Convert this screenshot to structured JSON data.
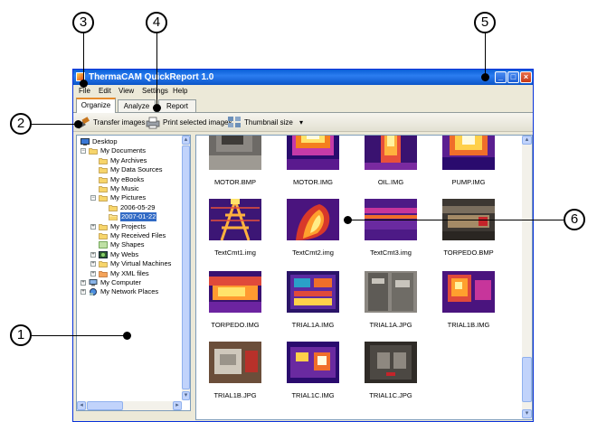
{
  "window": {
    "title": "ThermaCAM QuickReport 1.0",
    "controls": {
      "minimize": "_",
      "maximize": "□",
      "close": "×"
    }
  },
  "menu": [
    "File",
    "Edit",
    "View",
    "Settings",
    "Help"
  ],
  "tabs": [
    {
      "label": "Organize",
      "active": true
    },
    {
      "label": "Analyze",
      "active": false
    },
    {
      "label": "Report",
      "active": false
    }
  ],
  "toolbar": {
    "transfer": "Transfer images",
    "print": "Print selected images",
    "thumbnail": "Thumbnail size",
    "thumbnail_arrow": "▾"
  },
  "tree": [
    {
      "label": "Desktop",
      "level": 0,
      "expander": "",
      "icon": "desktop-icon"
    },
    {
      "label": "My Documents",
      "level": 1,
      "expander": "−",
      "icon": "folder-icon"
    },
    {
      "label": "My Archives",
      "level": 2,
      "expander": "",
      "icon": "folder-icon"
    },
    {
      "label": "My Data Sources",
      "level": 2,
      "expander": "",
      "icon": "folder-icon"
    },
    {
      "label": "My eBooks",
      "level": 2,
      "expander": "",
      "icon": "folder-icon"
    },
    {
      "label": "My Music",
      "level": 2,
      "expander": "",
      "icon": "folder-icon"
    },
    {
      "label": "My Pictures",
      "level": 2,
      "expander": "−",
      "icon": "folder-icon"
    },
    {
      "label": "2006-05-29",
      "level": 3,
      "expander": "",
      "icon": "folder-icon"
    },
    {
      "label": "2007-01-22",
      "level": 3,
      "expander": "",
      "icon": "folder-open-icon",
      "selected": true
    },
    {
      "label": "My Projects",
      "level": 2,
      "expander": "+",
      "icon": "folder-icon"
    },
    {
      "label": "My Received Files",
      "level": 2,
      "expander": "",
      "icon": "folder-icon"
    },
    {
      "label": "My Shapes",
      "level": 2,
      "expander": "",
      "icon": "shapes-icon"
    },
    {
      "label": "My Webs",
      "level": 2,
      "expander": "+",
      "icon": "webs-icon"
    },
    {
      "label": "My Virtual Machines",
      "level": 2,
      "expander": "+",
      "icon": "folder-icon"
    },
    {
      "label": "My XML files",
      "level": 2,
      "expander": "+",
      "icon": "xml-folder-icon"
    },
    {
      "label": "My Computer",
      "level": 1,
      "expander": "+",
      "icon": "computer-icon"
    },
    {
      "label": "My Network Places",
      "level": 1,
      "expander": "+",
      "icon": "network-icon"
    }
  ],
  "scroll_arrows": {
    "up": "▴",
    "down": "▾",
    "left": "◂",
    "right": "▸"
  },
  "images": [
    {
      "name": "MOTOR.BMP",
      "style": "photo-motor"
    },
    {
      "name": "MOTOR.IMG",
      "style": "ir-hot"
    },
    {
      "name": "OIL.IMG",
      "style": "ir-oil"
    },
    {
      "name": "PUMP.IMG",
      "style": "ir-pump"
    },
    {
      "name": "TextCmt1.img",
      "style": "ir-tower"
    },
    {
      "name": "TextCmt2.img",
      "style": "ir-flame"
    },
    {
      "name": "TextCmt3.img",
      "style": "ir-stripe"
    },
    {
      "name": "TORPEDO.BMP",
      "style": "photo-torpedo"
    },
    {
      "name": "TORPEDO.IMG",
      "style": "ir-torpedo"
    },
    {
      "name": "TRIAL1A.IMG",
      "style": "ir-panel"
    },
    {
      "name": "TRIAL1A.JPG",
      "style": "photo-panel"
    },
    {
      "name": "TRIAL1B.IMG",
      "style": "ir-trial1b"
    },
    {
      "name": "TRIAL1B.JPG",
      "style": "photo-machine"
    },
    {
      "name": "TRIAL1C.IMG",
      "style": "ir-trial1c"
    },
    {
      "name": "TRIAL1C.JPG",
      "style": "photo-cabinet"
    }
  ],
  "callouts": [
    "1",
    "2",
    "3",
    "4",
    "5",
    "6"
  ]
}
